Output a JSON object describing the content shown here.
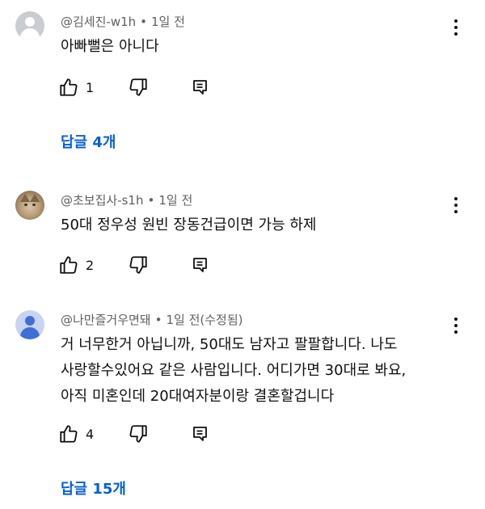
{
  "comments": [
    {
      "author": "@김세진-w1h",
      "time": "1일 전",
      "edited": "",
      "avatar": "default-gray",
      "lines": [
        "아빠뻘은 아니다"
      ],
      "likes": "1",
      "replies": "답글 4개"
    },
    {
      "author": "@초보집사-s1h",
      "time": "1일 전",
      "edited": "",
      "avatar": "cat-photo",
      "lines": [
        "50대  정우성 원빈 장동건급이면 가능 하제"
      ],
      "likes": "2",
      "replies": ""
    },
    {
      "author": "@나만즐거우면돼",
      "time": "1일 전",
      "edited": "(수정됨)",
      "avatar": "default-blue",
      "lines": [
        "거 너무한거 아닙니까, 50대도 남자고 팔팔합니다. 나도",
        "사랑할수있어요 같은 사람입니다. 어디가면 30대로 봐요,",
        "아직 미혼인데 20대여자분이랑 결혼할겁니다"
      ],
      "likes": "4",
      "replies": "답글 15개"
    }
  ],
  "icons": {
    "like": "thumb-up-icon",
    "dislike": "thumb-down-icon",
    "reply": "reply-comment-icon",
    "more": "more-vertical-icon"
  },
  "colors": {
    "link": "#065fd4",
    "meta": "#606060",
    "text": "#0f0f0f"
  }
}
